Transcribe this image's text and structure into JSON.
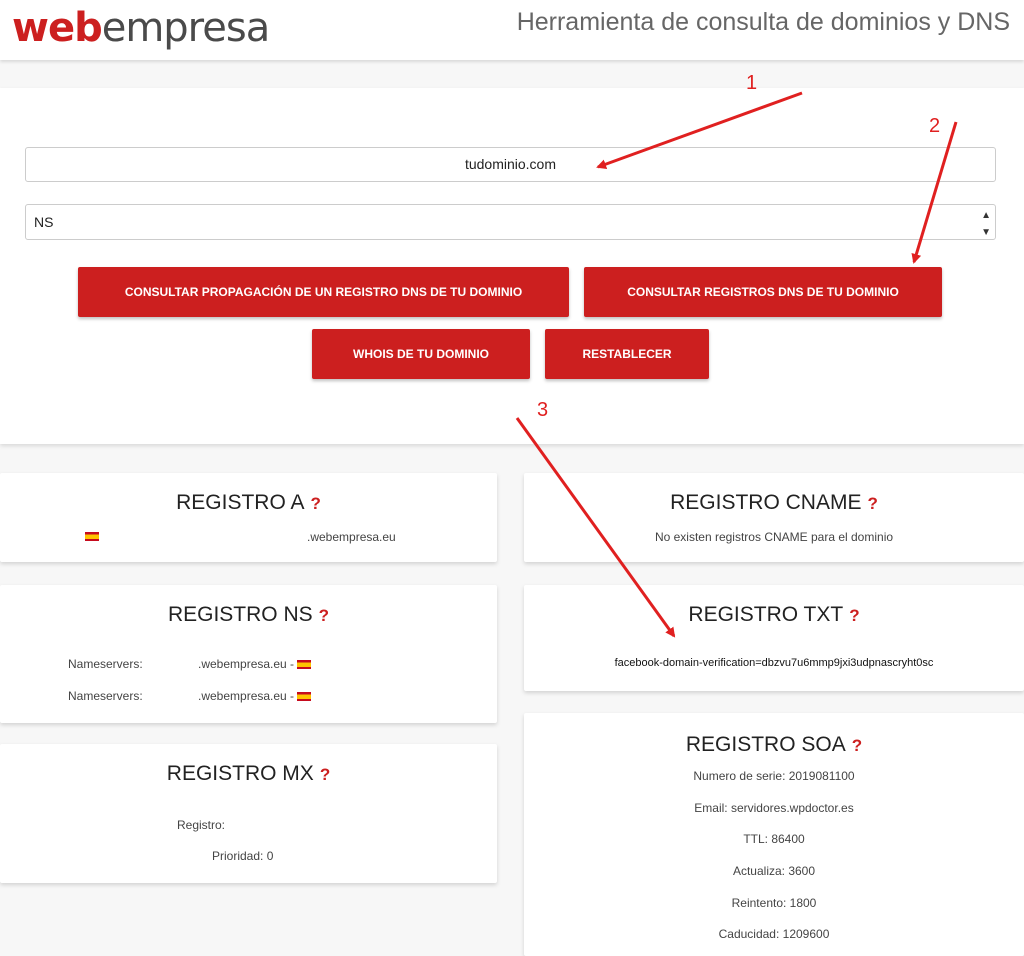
{
  "header": {
    "logo_part1": "web",
    "logo_part2": "empresa",
    "title": "Herramienta de consulta de dominios y DNS"
  },
  "form": {
    "domain_value": "tudominio.com",
    "record_type": "NS",
    "buttons": {
      "propagation": "CONSULTAR PROPAGACIÓN DE UN REGISTRO DNS DE TU DOMINIO",
      "dns_records": "CONSULTAR REGISTROS DNS DE TU DOMINIO",
      "whois": "WHOIS DE TU DOMINIO",
      "reset": "RESTABLECER"
    }
  },
  "help_symbol": "?",
  "cards": {
    "a": {
      "title": "REGISTRO A",
      "value": ".webempresa.eu"
    },
    "cname": {
      "title": "REGISTRO CNAME",
      "message": "No existen registros CNAME para el dominio"
    },
    "ns": {
      "title": "REGISTRO NS",
      "rows": [
        {
          "label": "Nameservers:",
          "value": ".webempresa.eu -"
        },
        {
          "label": "Nameservers:",
          "value": ".webempresa.eu -"
        }
      ]
    },
    "txt": {
      "title": "REGISTRO TXT",
      "value": "facebook-domain-verification=dbzvu7u6mmp9jxi3udpnascryht0sc"
    },
    "mx": {
      "title": "REGISTRO MX",
      "registro_label": "Registro:",
      "priority": "Prioridad: 0"
    },
    "soa": {
      "title": "REGISTRO SOA",
      "lines": [
        "Numero de serie: 2019081100",
        "Email: servidores.wpdoctor.es",
        "TTL: 86400",
        "Actualiza: 3600",
        "Reintento: 1800",
        "Caducidad: 1209600"
      ]
    }
  },
  "annotations": [
    "1",
    "2",
    "3"
  ],
  "colors": {
    "brand_red": "#cc1f1f",
    "annotation_red": "#e02020"
  },
  "icons": {
    "flag": "spain-flag-icon",
    "select": "select-arrows-icon"
  }
}
